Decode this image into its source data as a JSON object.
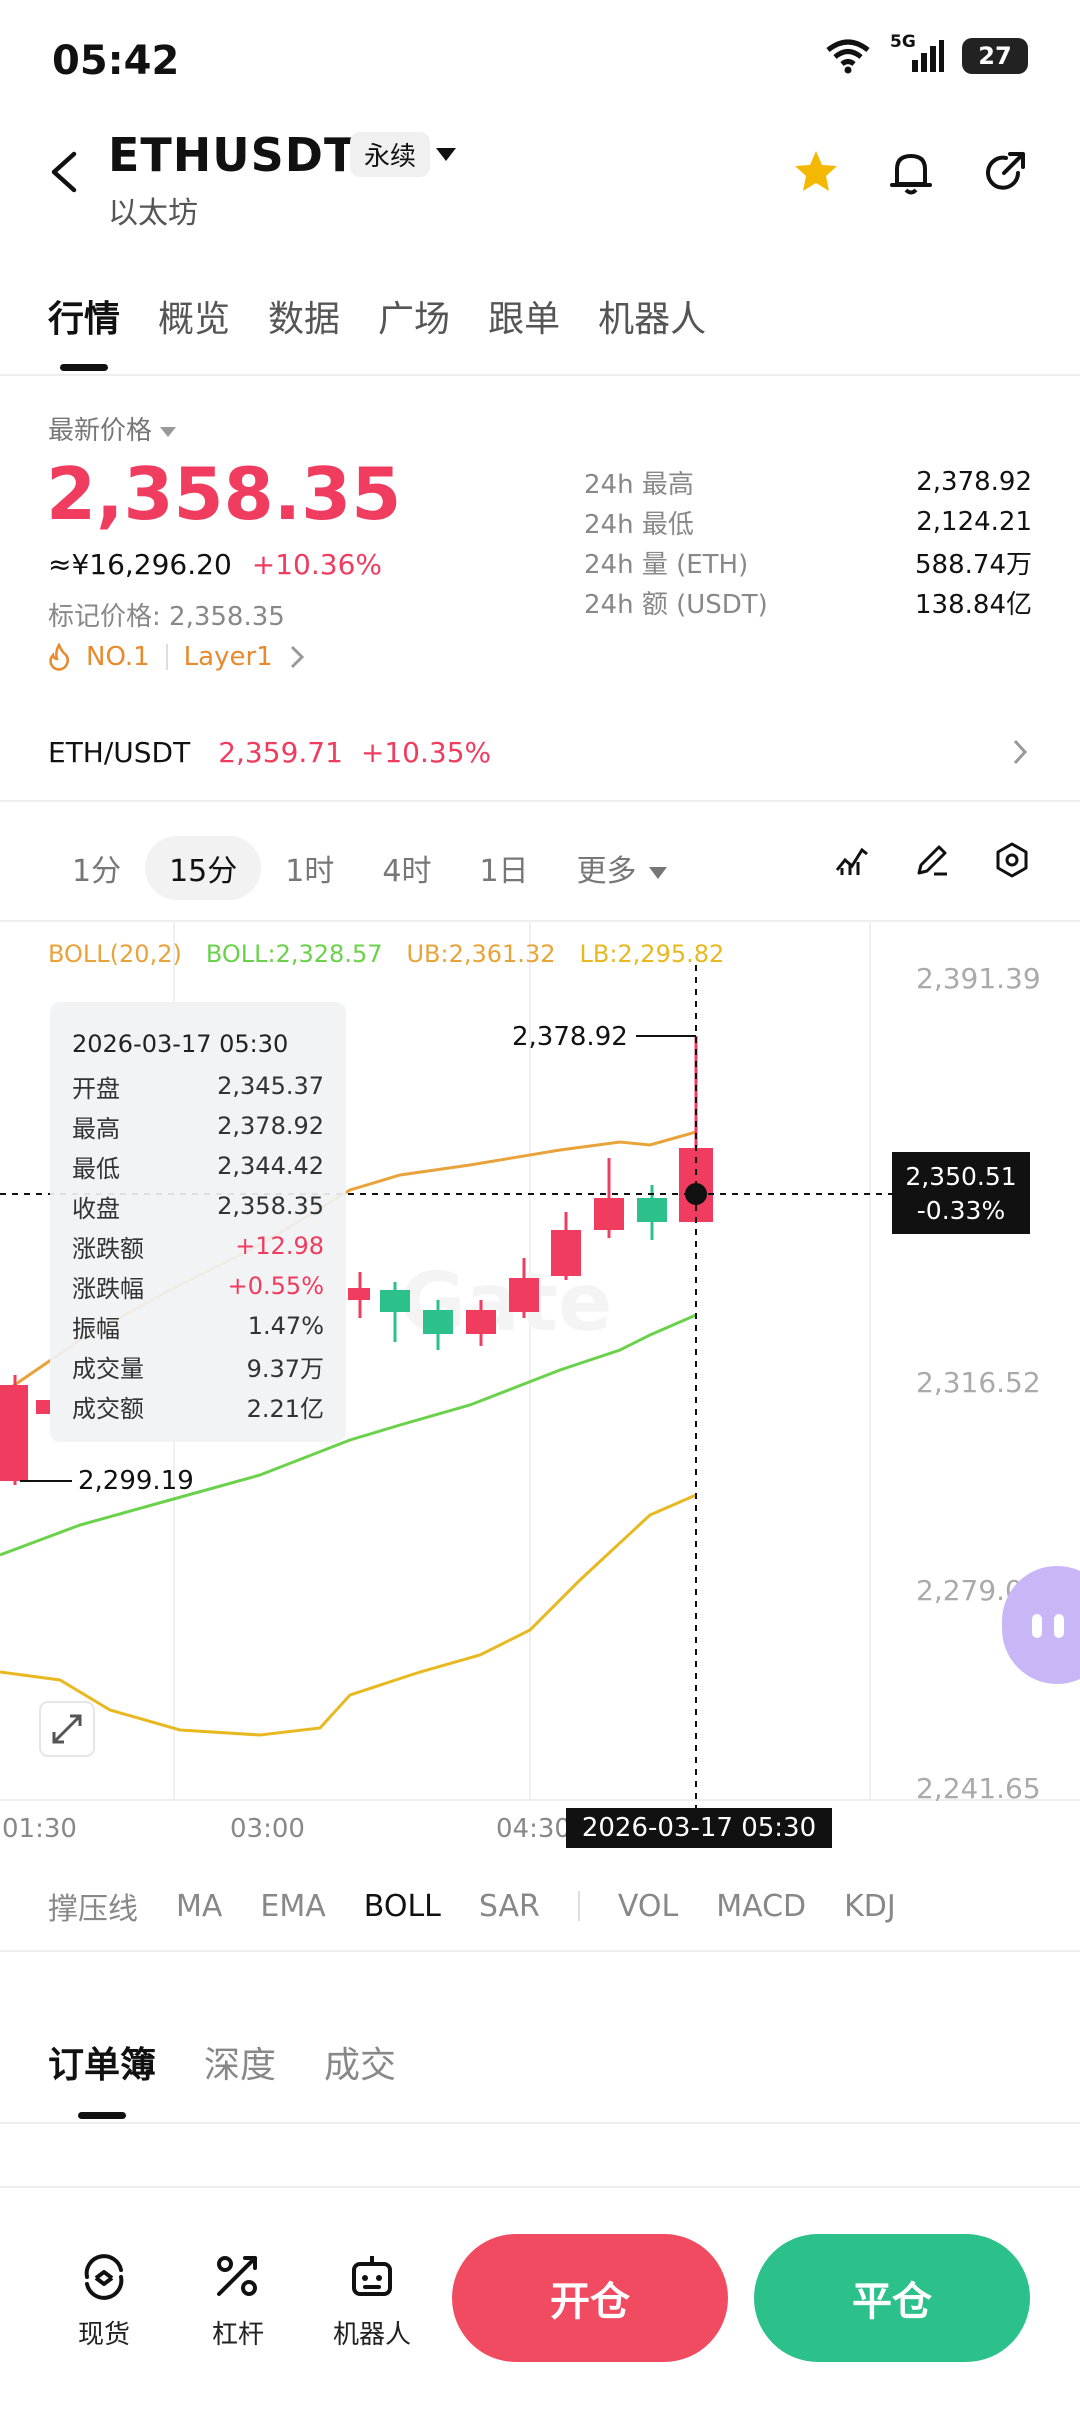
{
  "status": {
    "time": "05:42",
    "network": "5G",
    "battery": "27"
  },
  "header": {
    "pair": "ETHUSDT",
    "contract": "永续",
    "subtitle": "以太坊"
  },
  "tabs": [
    "行情",
    "概览",
    "数据",
    "广场",
    "跟单",
    "机器人"
  ],
  "price": {
    "label": "最新价格",
    "last": "2,358.35",
    "cny": "≈¥16,296.20",
    "change": "+10.36%",
    "mark": "标记价格: 2,358.35",
    "tag1": "NO.1",
    "tag2": "Layer1"
  },
  "stats": [
    {
      "k": "24h  最高",
      "v": "2,378.92"
    },
    {
      "k": "24h  最低",
      "v": "2,124.21"
    },
    {
      "k": "24h  量 (ETH)",
      "v": "588.74万"
    },
    {
      "k": "24h  额 (USDT)",
      "v": "138.84亿"
    }
  ],
  "spot": {
    "pair": "ETH/USDT",
    "price": "2,359.71",
    "change": "+10.35%"
  },
  "timeframes": [
    "1分",
    "15分",
    "1时",
    "4时",
    "1日",
    "更多"
  ],
  "boll": {
    "name": "BOLL(20,2)",
    "mid": "BOLL:2,328.57",
    "ub": "UB:2,361.32",
    "lb": "LB:2,295.82"
  },
  "axis": {
    "y": [
      "2,391.39",
      "2,316.52",
      "2,279.09",
      "2,241.65"
    ],
    "x": [
      "01:30",
      "03:00",
      "04:30"
    ]
  },
  "chart_annotations": {
    "high": "2,378.92",
    "low": "2,299.19",
    "cross_price": "2,350.51",
    "cross_pct": "-0.33%",
    "cross_time": "2026-03-17 05:30"
  },
  "tooltip": {
    "time": "2026-03-17 05:30",
    "rows": [
      {
        "k": "开盘",
        "v": "2,345.37"
      },
      {
        "k": "最高",
        "v": "2,378.92"
      },
      {
        "k": "最低",
        "v": "2,344.42"
      },
      {
        "k": "收盘",
        "v": "2,358.35"
      },
      {
        "k": "涨跌额",
        "v": "+12.98"
      },
      {
        "k": "涨跌幅",
        "v": "+0.55%"
      },
      {
        "k": "振幅",
        "v": "1.47%"
      },
      {
        "k": "成交量",
        "v": "9.37万"
      },
      {
        "k": "成交额",
        "v": "2.21亿"
      }
    ]
  },
  "indicators": [
    "撑压线",
    "MA",
    "EMA",
    "BOLL",
    "SAR",
    "VOL",
    "MACD",
    "KDJ"
  ],
  "orderbook_tabs": [
    "订单簿",
    "深度",
    "成交"
  ],
  "bottom_nav": [
    "现货",
    "杠杆",
    "机器人"
  ],
  "buttons": {
    "open": "开仓",
    "close": "平仓"
  },
  "colors": {
    "up": "#ef3c5f",
    "down": "#2cc08a",
    "accent": "#e88a2e"
  }
}
